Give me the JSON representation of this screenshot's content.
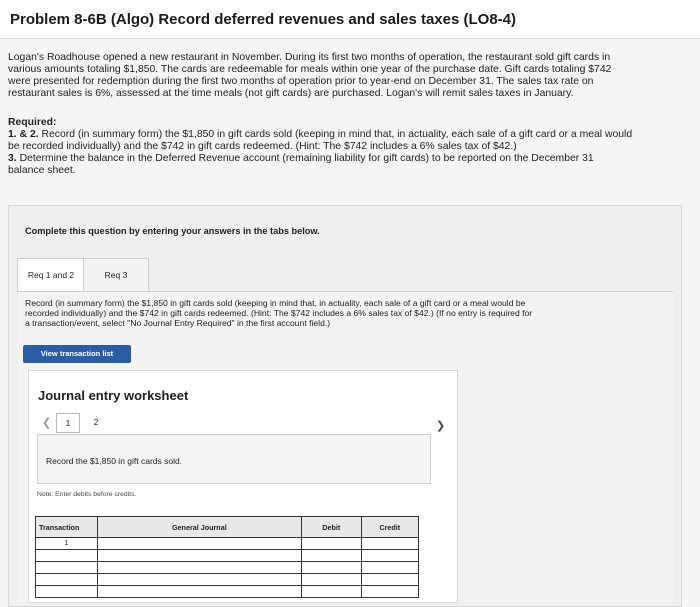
{
  "problem": {
    "title": "Problem 8-6B (Algo) Record deferred revenues and sales taxes (LO8-4)",
    "intro_lines": [
      "Logan's Roadhouse opened a new restaurant in November. During its first two months of operation, the restaurant sold gift cards in",
      "various amounts totaling $1,850. The cards are redeemable for meals within one year of the purchase date. Gift cards totaling $742",
      "were presented for redemption during the first two months of operation prior to year-end on December 31. The sales tax rate on",
      "restaurant sales is 6%, assessed at the time meals (not gift cards) are purchased. Logan's will remit sales taxes in January."
    ],
    "required_label": "Required:",
    "req1_num": "1. & 2.",
    "req1_lines": [
      "Record (in summary form) the $1,850 in gift cards sold (keeping in mind that, in actuality, each sale of a gift card or a meal would",
      "be recorded individually) and the $742 in gift cards redeemed. (Hint: The $742 includes a 6% sales tax of $42.)"
    ],
    "req3_num": "3.",
    "req3_lines": [
      "Determine the balance in the Deferred Revenue account (remaining liability for gift cards) to be reported on the December 31",
      "balance sheet."
    ]
  },
  "panel": {
    "heading": "Complete this question by entering your answers in the tabs below.",
    "tabs": [
      {
        "label": "Req 1 and 2",
        "active": true
      },
      {
        "label": "Req 3",
        "active": false
      }
    ],
    "instruction_lines": [
      "Record (in summary form) the $1,850 in gift cards sold (keeping in mind that, in actuality, each sale of a gift card or a meal would be",
      "recorded individually) and the $742 in gift cards redeemed. (Hint: The $742 includes a 6% sales tax of $42.) (If no entry is required for",
      "a transaction/event, select \"No Journal Entry Required\" in the first account field.)"
    ],
    "view_button": "View transaction list"
  },
  "worksheet": {
    "title": "Journal entry worksheet",
    "prev_icon": "chevron-left-icon",
    "next_icon": "chevron-right-icon",
    "pages": [
      "1",
      "2"
    ],
    "current_page": "1",
    "description": "Record the $1,850 in gift cards sold.",
    "note": "Note: Enter debits before credits.",
    "table": {
      "headers": [
        "Transaction",
        "General Journal",
        "Debit",
        "Credit"
      ],
      "rows": [
        [
          "1",
          "",
          "",
          ""
        ],
        [
          "",
          "",
          "",
          ""
        ],
        [
          "",
          "",
          "",
          ""
        ],
        [
          "",
          "",
          "",
          ""
        ],
        [
          "",
          "",
          "",
          ""
        ]
      ]
    }
  },
  "colors": {
    "button_blue": "#2a5da8"
  }
}
